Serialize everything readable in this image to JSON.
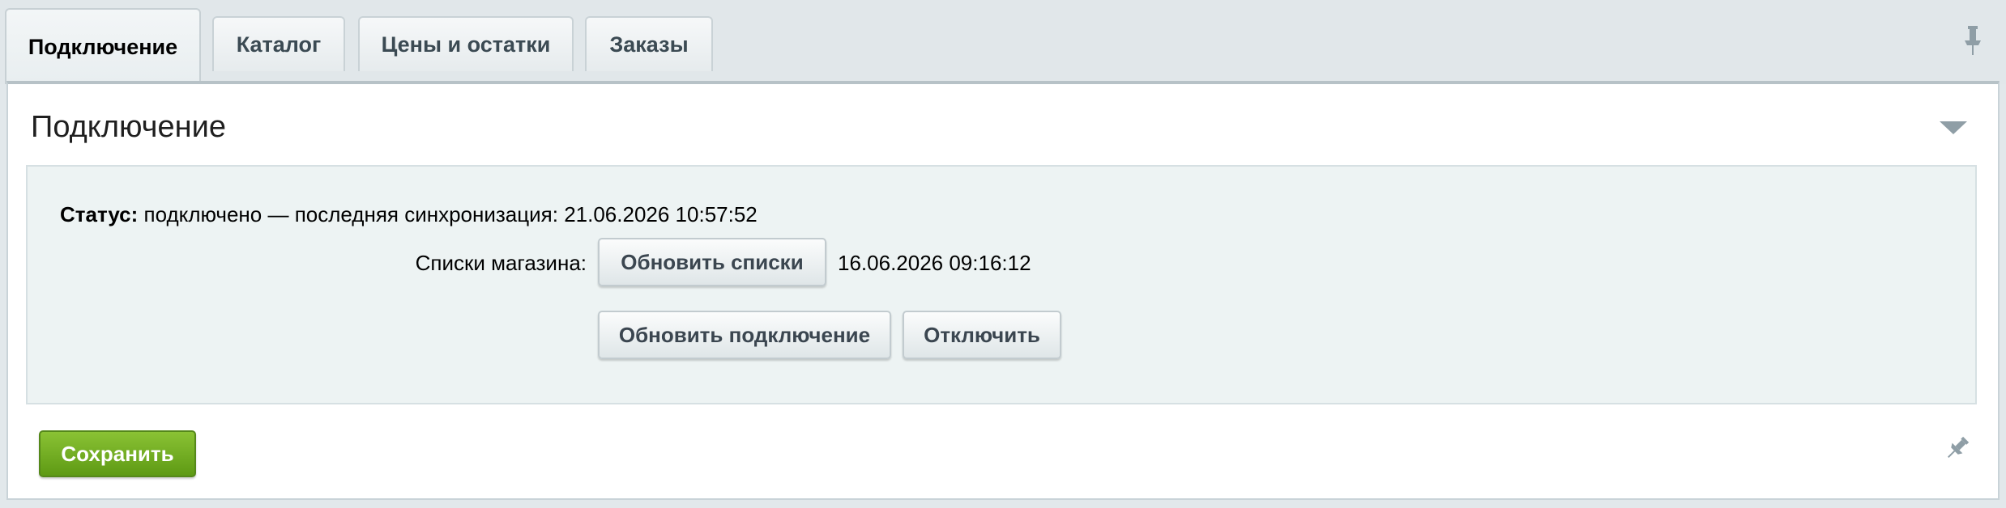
{
  "tabs": [
    {
      "label": "Подключение"
    },
    {
      "label": "Каталог"
    },
    {
      "label": "Цены и остатки"
    },
    {
      "label": "Заказы"
    }
  ],
  "section": {
    "title": "Подключение"
  },
  "status": {
    "label": "Статус:",
    "text": "подключено — последняя синхронизация: 21.06.2026 10:57:52"
  },
  "shop_lists": {
    "label": "Списки магазина:",
    "update_button": "Обновить списки",
    "timestamp": "16.06.2026 09:16:12"
  },
  "connection_actions": {
    "update_button": "Обновить подключение",
    "disconnect_button": "Отключить"
  },
  "footer": {
    "save_button": "Сохранить"
  },
  "icons": {
    "pin_top": "pin-icon",
    "collapse": "chevron-down-icon",
    "pin_bottom": "pin-icon"
  },
  "colors": {
    "save_button": "#6fa822",
    "background": "#e2e8eb",
    "settings_box": "#edf3f3"
  }
}
